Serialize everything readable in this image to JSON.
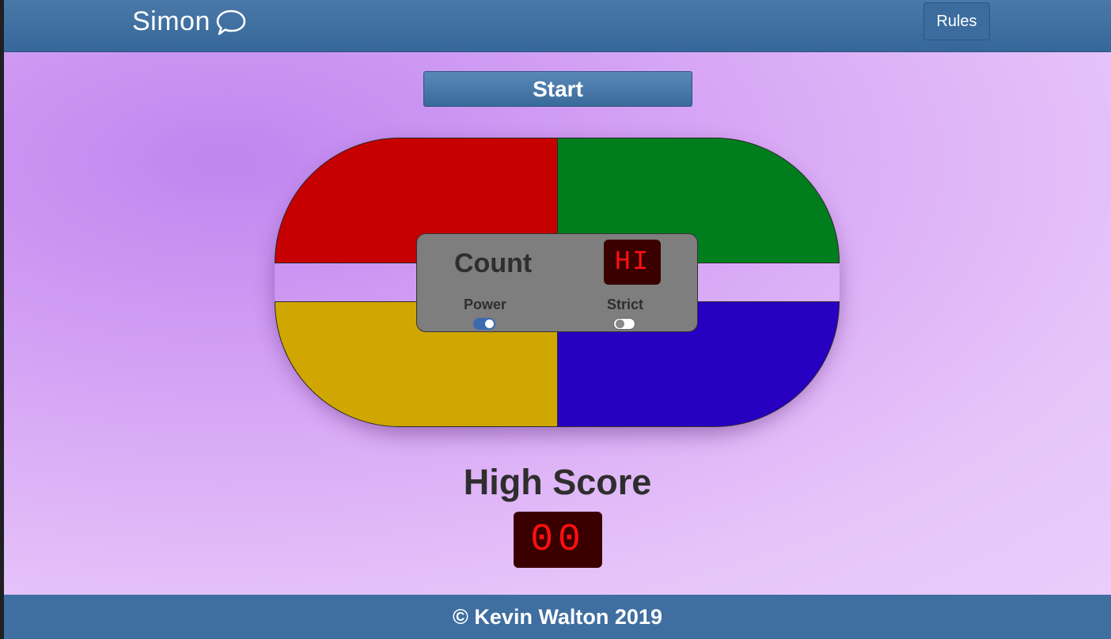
{
  "header": {
    "brand": "Simon",
    "brand_icon": "speech-bubble-icon",
    "rules_label": "Rules"
  },
  "controls": {
    "start_label": "Start",
    "count_label": "Count",
    "count_display": "HI",
    "power_label": "Power",
    "power_on": true,
    "strict_label": "Strict",
    "strict_on": false
  },
  "pads": {
    "top_left": "#c60000",
    "top_right": "#007e1d",
    "bottom_left": "#d0a600",
    "bottom_right": "#2700c2"
  },
  "high_score": {
    "title": "High Score",
    "value": "00"
  },
  "footer": {
    "text": "© Kevin Walton 2019"
  }
}
